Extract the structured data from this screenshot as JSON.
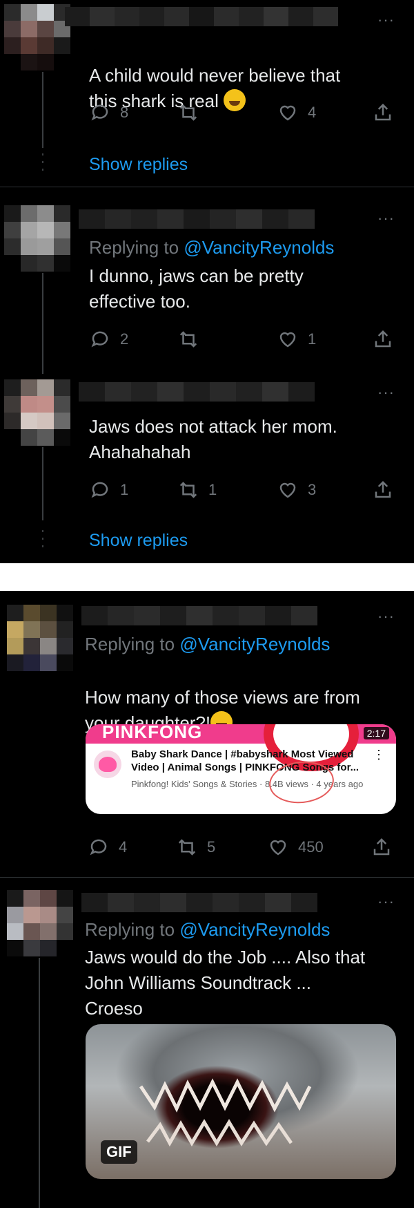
{
  "colors": {
    "background": "#000000",
    "text": "#e7e9ea",
    "muted": "#71767b",
    "link": "#1d9bf0",
    "divider": "#2f3336"
  },
  "more_icon_glyph": "···",
  "section1": {
    "tweets": [
      {
        "text": "A child would never believe that\nthis shark is real",
        "emoji": "rolling-on-floor-laughing-emoji",
        "replies": "8",
        "retweets": "",
        "likes": "4",
        "show_replies": "Show replies"
      },
      {
        "replying_prefix": "Replying to ",
        "replying_handle": "@VancityReynolds",
        "text": "I dunno, jaws can be pretty\neffective too.",
        "replies": "2",
        "retweets": "",
        "likes": "1"
      },
      {
        "text": "Jaws does not attack her mom.\nAhahahahah",
        "replies": "1",
        "retweets": "1",
        "likes": "3",
        "show_replies": "Show replies"
      }
    ]
  },
  "section2": {
    "tweets": [
      {
        "replying_prefix": "Replying to ",
        "replying_handle": "@VancityReynolds",
        "text": "How many of those views are from\nyour daughter?!",
        "emoji": "grinning-face-emoji",
        "card": {
          "brand": "PINKFONG",
          "duration": "2:17",
          "title": "Baby Shark Dance | #babyshark Most Viewed Video | Animal Songs | PINKFONG Songs for...",
          "meta": "Pinkfong! Kids' Songs & Stories · 8.4B views · 4 years ago",
          "menu_glyph": "⋮"
        },
        "replies": "4",
        "retweets": "5",
        "likes": "450"
      },
      {
        "replying_prefix": "Replying to ",
        "replying_handle": "@VancityReynolds",
        "text": "Jaws would do the Job .... Also that\nJohn Williams Soundtrack ...\nCroeso",
        "gif_badge": "GIF"
      }
    ]
  }
}
